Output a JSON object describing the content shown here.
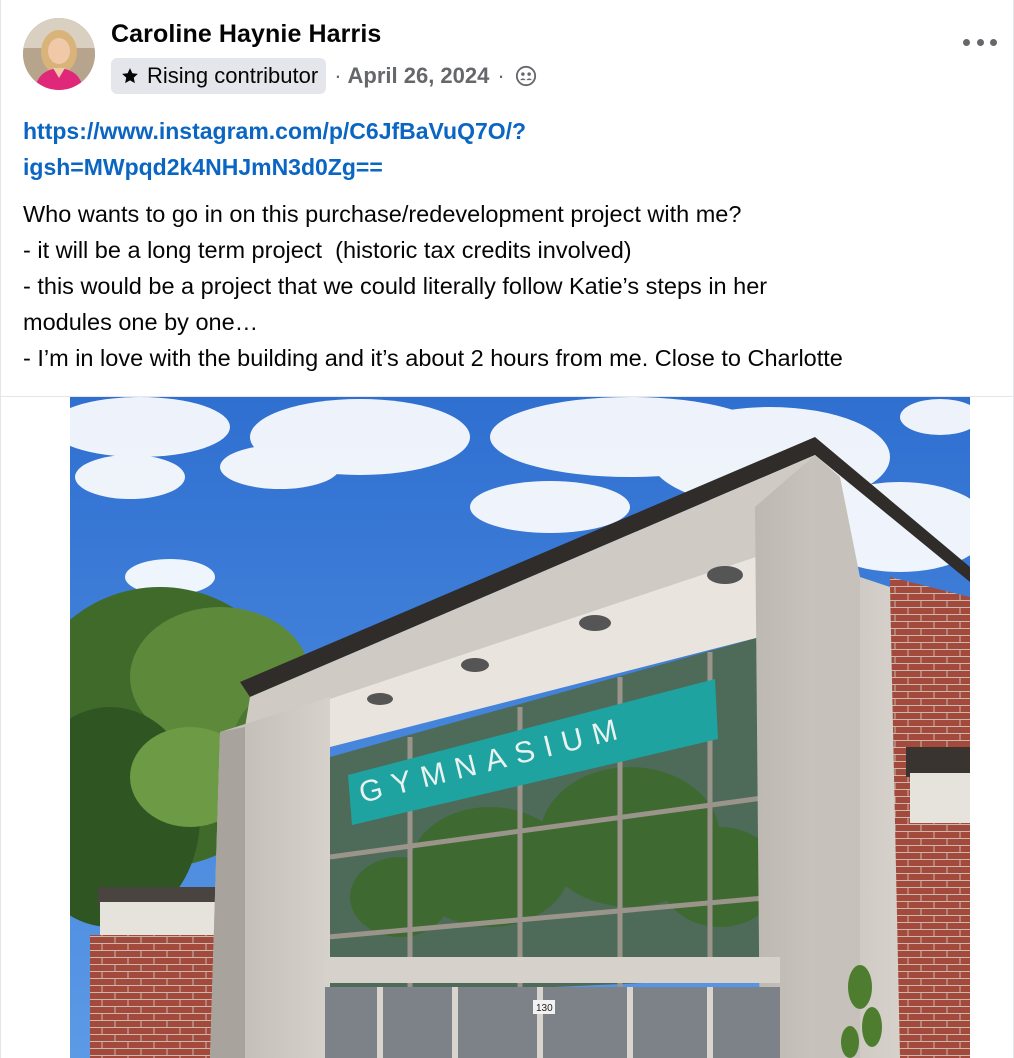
{
  "post": {
    "author": "Caroline Haynie Harris",
    "badge": "Rising contributor",
    "date": "April 26, 2024",
    "link_line1": "https://www.instagram.com/p/C6JfBaVuQ7O/?",
    "link_line2": "igsh=MWpqd2k4NHJmN3d0Zg==",
    "lines": [
      "Who wants to go in on this purchase/redevelopment project with me?",
      "- it will be a long term project  (historic tax credits involved)",
      "- this would be a project that we could literally follow Katie’s steps in her",
      "modules one by one…",
      "- I’m in love with the building and it’s about 2 hours from me. Close to Charlotte"
    ],
    "photo_sign": "GYMNASIUM",
    "door_number": "130"
  },
  "icons": {
    "badge": "star-icon",
    "privacy": "group-privacy-icon",
    "menu": "more-options-icon"
  },
  "colors": {
    "link": "#0a66c2",
    "meta": "#65676b",
    "badge_bg": "#e4e6eb",
    "sign": "#1fa3a0"
  }
}
